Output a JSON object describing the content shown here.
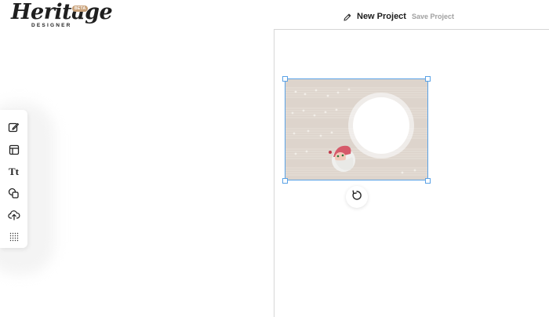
{
  "brand": {
    "script": "Heritage",
    "sub": "DESIGNER",
    "badge": "BETA"
  },
  "header": {
    "title": "New Project",
    "save_label": "Save Project",
    "edit_icon": "pencil-icon"
  },
  "toolbar": {
    "items": [
      {
        "name": "edit-tool",
        "icon": "edit-icon"
      },
      {
        "name": "layout-tool",
        "icon": "layout-icon"
      },
      {
        "name": "text-tool",
        "icon": "text-icon",
        "label": "Tt"
      },
      {
        "name": "shapes-tool",
        "icon": "shapes-icon"
      },
      {
        "name": "upload-tool",
        "icon": "upload-icon"
      },
      {
        "name": "pattern-tool",
        "icon": "grid-dots-icon"
      }
    ]
  },
  "canvas": {
    "selection_color": "#5aa2e6",
    "card_background": "#ddd4cc"
  }
}
